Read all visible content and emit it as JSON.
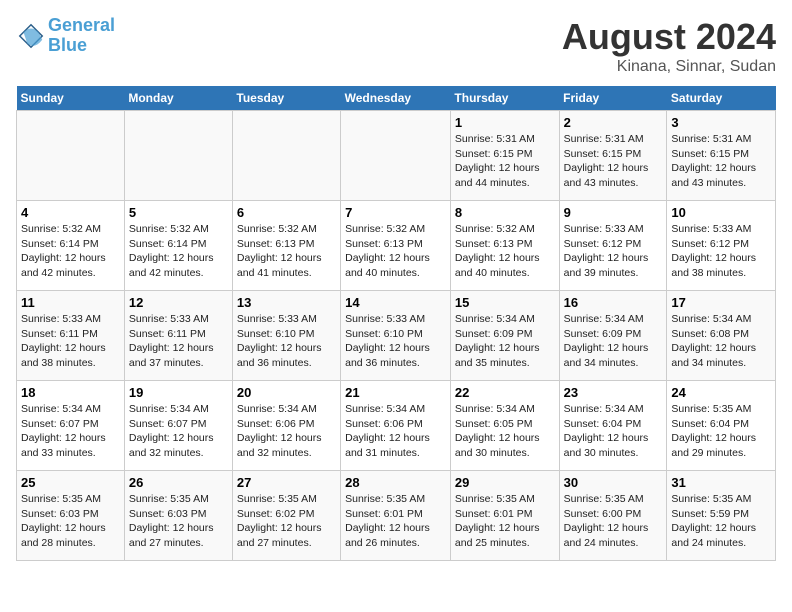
{
  "header": {
    "logo_line1": "General",
    "logo_line2": "Blue",
    "title": "August 2024",
    "subtitle": "Kinana, Sinnar, Sudan"
  },
  "days_of_week": [
    "Sunday",
    "Monday",
    "Tuesday",
    "Wednesday",
    "Thursday",
    "Friday",
    "Saturday"
  ],
  "weeks": [
    {
      "cells": [
        {
          "day": null,
          "text": null
        },
        {
          "day": null,
          "text": null
        },
        {
          "day": null,
          "text": null
        },
        {
          "day": null,
          "text": null
        },
        {
          "day": "1",
          "text": "Sunrise: 5:31 AM\nSunset: 6:15 PM\nDaylight: 12 hours\nand 44 minutes."
        },
        {
          "day": "2",
          "text": "Sunrise: 5:31 AM\nSunset: 6:15 PM\nDaylight: 12 hours\nand 43 minutes."
        },
        {
          "day": "3",
          "text": "Sunrise: 5:31 AM\nSunset: 6:15 PM\nDaylight: 12 hours\nand 43 minutes."
        }
      ]
    },
    {
      "cells": [
        {
          "day": "4",
          "text": "Sunrise: 5:32 AM\nSunset: 6:14 PM\nDaylight: 12 hours\nand 42 minutes."
        },
        {
          "day": "5",
          "text": "Sunrise: 5:32 AM\nSunset: 6:14 PM\nDaylight: 12 hours\nand 42 minutes."
        },
        {
          "day": "6",
          "text": "Sunrise: 5:32 AM\nSunset: 6:13 PM\nDaylight: 12 hours\nand 41 minutes."
        },
        {
          "day": "7",
          "text": "Sunrise: 5:32 AM\nSunset: 6:13 PM\nDaylight: 12 hours\nand 40 minutes."
        },
        {
          "day": "8",
          "text": "Sunrise: 5:32 AM\nSunset: 6:13 PM\nDaylight: 12 hours\nand 40 minutes."
        },
        {
          "day": "9",
          "text": "Sunrise: 5:33 AM\nSunset: 6:12 PM\nDaylight: 12 hours\nand 39 minutes."
        },
        {
          "day": "10",
          "text": "Sunrise: 5:33 AM\nSunset: 6:12 PM\nDaylight: 12 hours\nand 38 minutes."
        }
      ]
    },
    {
      "cells": [
        {
          "day": "11",
          "text": "Sunrise: 5:33 AM\nSunset: 6:11 PM\nDaylight: 12 hours\nand 38 minutes."
        },
        {
          "day": "12",
          "text": "Sunrise: 5:33 AM\nSunset: 6:11 PM\nDaylight: 12 hours\nand 37 minutes."
        },
        {
          "day": "13",
          "text": "Sunrise: 5:33 AM\nSunset: 6:10 PM\nDaylight: 12 hours\nand 36 minutes."
        },
        {
          "day": "14",
          "text": "Sunrise: 5:33 AM\nSunset: 6:10 PM\nDaylight: 12 hours\nand 36 minutes."
        },
        {
          "day": "15",
          "text": "Sunrise: 5:34 AM\nSunset: 6:09 PM\nDaylight: 12 hours\nand 35 minutes."
        },
        {
          "day": "16",
          "text": "Sunrise: 5:34 AM\nSunset: 6:09 PM\nDaylight: 12 hours\nand 34 minutes."
        },
        {
          "day": "17",
          "text": "Sunrise: 5:34 AM\nSunset: 6:08 PM\nDaylight: 12 hours\nand 34 minutes."
        }
      ]
    },
    {
      "cells": [
        {
          "day": "18",
          "text": "Sunrise: 5:34 AM\nSunset: 6:07 PM\nDaylight: 12 hours\nand 33 minutes."
        },
        {
          "day": "19",
          "text": "Sunrise: 5:34 AM\nSunset: 6:07 PM\nDaylight: 12 hours\nand 32 minutes."
        },
        {
          "day": "20",
          "text": "Sunrise: 5:34 AM\nSunset: 6:06 PM\nDaylight: 12 hours\nand 32 minutes."
        },
        {
          "day": "21",
          "text": "Sunrise: 5:34 AM\nSunset: 6:06 PM\nDaylight: 12 hours\nand 31 minutes."
        },
        {
          "day": "22",
          "text": "Sunrise: 5:34 AM\nSunset: 6:05 PM\nDaylight: 12 hours\nand 30 minutes."
        },
        {
          "day": "23",
          "text": "Sunrise: 5:34 AM\nSunset: 6:04 PM\nDaylight: 12 hours\nand 30 minutes."
        },
        {
          "day": "24",
          "text": "Sunrise: 5:35 AM\nSunset: 6:04 PM\nDaylight: 12 hours\nand 29 minutes."
        }
      ]
    },
    {
      "cells": [
        {
          "day": "25",
          "text": "Sunrise: 5:35 AM\nSunset: 6:03 PM\nDaylight: 12 hours\nand 28 minutes."
        },
        {
          "day": "26",
          "text": "Sunrise: 5:35 AM\nSunset: 6:03 PM\nDaylight: 12 hours\nand 27 minutes."
        },
        {
          "day": "27",
          "text": "Sunrise: 5:35 AM\nSunset: 6:02 PM\nDaylight: 12 hours\nand 27 minutes."
        },
        {
          "day": "28",
          "text": "Sunrise: 5:35 AM\nSunset: 6:01 PM\nDaylight: 12 hours\nand 26 minutes."
        },
        {
          "day": "29",
          "text": "Sunrise: 5:35 AM\nSunset: 6:01 PM\nDaylight: 12 hours\nand 25 minutes."
        },
        {
          "day": "30",
          "text": "Sunrise: 5:35 AM\nSunset: 6:00 PM\nDaylight: 12 hours\nand 24 minutes."
        },
        {
          "day": "31",
          "text": "Sunrise: 5:35 AM\nSunset: 5:59 PM\nDaylight: 12 hours\nand 24 minutes."
        }
      ]
    }
  ]
}
